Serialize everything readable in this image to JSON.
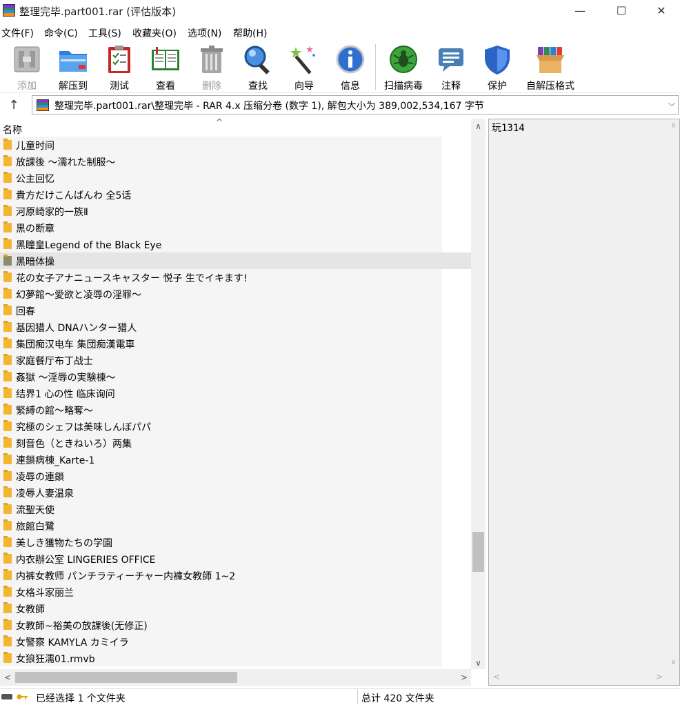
{
  "window": {
    "title": "整理完毕.part001.rar (评估版本)",
    "minimize": "—",
    "maximize": "☐",
    "close": "✕"
  },
  "menu": [
    "文件(F)",
    "命令(C)",
    "工具(S)",
    "收藏夹(O)",
    "选项(N)",
    "帮助(H)"
  ],
  "toolbar": [
    {
      "label": "添加",
      "icon": "add-icon",
      "enabled": false
    },
    {
      "label": "解压到",
      "icon": "extract-folder-icon",
      "enabled": true
    },
    {
      "label": "测试",
      "icon": "test-clipboard-icon",
      "enabled": true
    },
    {
      "label": "查看",
      "icon": "view-book-icon",
      "enabled": true
    },
    {
      "label": "删除",
      "icon": "trash-icon",
      "enabled": false
    },
    {
      "label": "查找",
      "icon": "magnifier-icon",
      "enabled": true
    },
    {
      "label": "向导",
      "icon": "wizard-wand-icon",
      "enabled": true
    },
    {
      "label": "信息",
      "icon": "info-icon",
      "enabled": true
    },
    {
      "label": "扫描病毒",
      "icon": "virus-scan-icon",
      "enabled": true
    },
    {
      "label": "注释",
      "icon": "comment-icon",
      "enabled": true
    },
    {
      "label": "保护",
      "icon": "shield-icon",
      "enabled": true
    },
    {
      "label": "自解压格式",
      "icon": "sfx-box-icon",
      "enabled": true
    }
  ],
  "address": {
    "up_icon": "↑",
    "path": "整理完毕.part001.rar\\整理完毕 - RAR 4.x 压缩分卷 (数字 1), 解包大小为 389,002,534,167 字节",
    "dropdown": "⌵"
  },
  "filelist": {
    "column_name": "名称",
    "sort_indicator": "^",
    "selected_index": 7,
    "rows": [
      "儿童时间",
      "放課後 ～濡れた制服～",
      "公主回忆",
      "貴方だけこんばんわ 全5话",
      "河原崎家的一族Ⅱ",
      "黒の断章",
      "黑瞳皇Legend of the Black Eye",
      "黑暗体操",
      "花の女子アナニュースキャスター 悦子 生でイキます!",
      "幻夢館～愛欲と凌辱の淫罪～",
      "回春",
      "基因猎人 DNAハンター猎人",
      "集団痴汉电车 集団痴漢電車",
      "家庭餐厅布丁战士",
      "姦獄 ～淫辱の実験棟～",
      "结界1 心の性 临床询问",
      "緊縛の館～略奪～",
      "究極のシェフは美味しんぼパパ",
      "刻音色（ときねいろ）两集",
      "連鎖病棟_Karte-1",
      "凌辱の連鎖",
      "凌辱人妻温泉",
      "流聖天使",
      "旅館白鷺",
      "美しき獲物たちの学園",
      "内衣辦公室 LINGERIES OFFICE",
      "内裤女教师 パンチラティーチャー内褲女教師 1~2",
      "女格斗家丽兰",
      "女教師",
      "女教師~裕美の放課後(无修正)",
      "女警察 KAMYLA カミイラ",
      "女狼狂濡01.rmvb"
    ]
  },
  "scroll": {
    "up": "∧",
    "down": "∨",
    "left": "<",
    "right": ">"
  },
  "comment": {
    "text": "玩1314"
  },
  "status": {
    "left": "已经选择 1 个文件夹",
    "right": "总计 420 文件夹"
  }
}
